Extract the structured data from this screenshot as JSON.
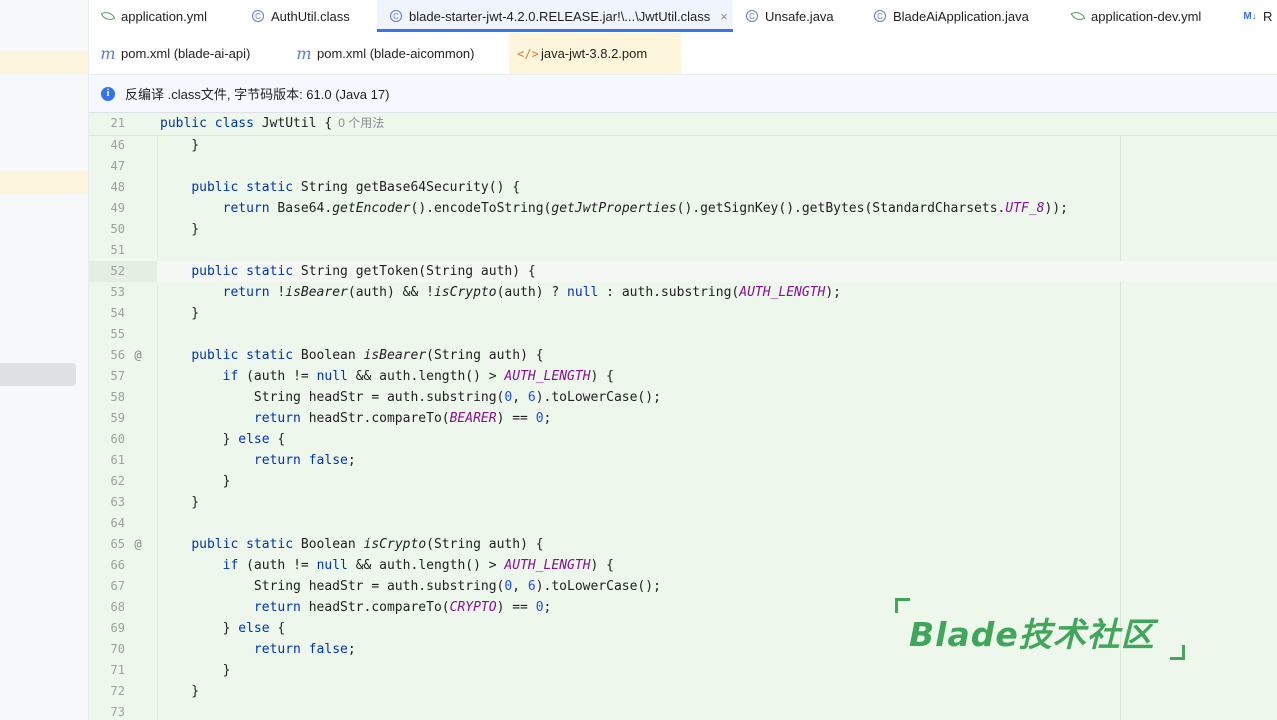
{
  "tabs_row1": [
    {
      "label": "application.yml",
      "icon": "leaf-icon",
      "active": false
    },
    {
      "label": "AuthUtil.class",
      "icon": "class-icon",
      "active": false
    },
    {
      "label": "blade-starter-jwt-4.2.0.RELEASE.jar!\\...\\JwtUtil.class",
      "icon": "class-icon",
      "active": true
    },
    {
      "label": "Unsafe.java",
      "icon": "class-icon",
      "active": false
    },
    {
      "label": "BladeAiApplication.java",
      "icon": "class-icon",
      "active": false
    },
    {
      "label": "application-dev.yml",
      "icon": "leaf-icon",
      "active": false
    },
    {
      "label": "R",
      "icon": "markdown-icon",
      "active": false
    }
  ],
  "tabs_row2": [
    {
      "label": "pom.xml (blade-ai-api)",
      "icon": "maven-icon"
    },
    {
      "label": "pom.xml (blade-aicommon)",
      "icon": "maven-icon"
    },
    {
      "label": "java-jwt-3.8.2.pom",
      "icon": "xml-icon"
    }
  ],
  "banner": {
    "text": "反编译 .class文件, 字节码版本: 61.0 (Java 17)",
    "icon": "info-icon"
  },
  "sticky": {
    "num": "21",
    "code_html": "<span class=\"kw\">public class</span> JwtUtil {<span class=\"hint\">0 个用法</span>"
  },
  "lines": [
    {
      "num": "46",
      "code": "    }"
    },
    {
      "num": "47",
      "code": ""
    },
    {
      "num": "48",
      "code": "    public static String getBase64Security() {"
    },
    {
      "num": "49",
      "code": "        return Base64.getEncoder().encodeToString(getJwtProperties().getSignKey().getBytes(StandardCharsets.UTF_8));"
    },
    {
      "num": "50",
      "code": "    }"
    },
    {
      "num": "51",
      "code": ""
    },
    {
      "num": "52",
      "code": "    public static String getToken(String auth) {",
      "current": true
    },
    {
      "num": "53",
      "code": "        return !isBearer(auth) && !isCrypto(auth) ? null : auth.substring(AUTH_LENGTH);"
    },
    {
      "num": "54",
      "code": "    }"
    },
    {
      "num": "55",
      "code": ""
    },
    {
      "num": "56",
      "code": "    public static Boolean isBearer(String auth) {",
      "marker": "@"
    },
    {
      "num": "57",
      "code": "        if (auth != null && auth.length() > AUTH_LENGTH) {"
    },
    {
      "num": "58",
      "code": "            String headStr = auth.substring(0, 6).toLowerCase();"
    },
    {
      "num": "59",
      "code": "            return headStr.compareTo(BEARER) == 0;"
    },
    {
      "num": "60",
      "code": "        } else {"
    },
    {
      "num": "61",
      "code": "            return false;"
    },
    {
      "num": "62",
      "code": "        }"
    },
    {
      "num": "63",
      "code": "    }"
    },
    {
      "num": "64",
      "code": ""
    },
    {
      "num": "65",
      "code": "    public static Boolean isCrypto(String auth) {",
      "marker": "@"
    },
    {
      "num": "66",
      "code": "        if (auth != null && auth.length() > AUTH_LENGTH) {"
    },
    {
      "num": "67",
      "code": "            String headStr = auth.substring(0, 6).toLowerCase();"
    },
    {
      "num": "68",
      "code": "            return headStr.compareTo(CRYPTO) == 0;"
    },
    {
      "num": "69",
      "code": "        } else {"
    },
    {
      "num": "70",
      "code": "            return false;"
    },
    {
      "num": "71",
      "code": "        }"
    },
    {
      "num": "72",
      "code": "    }"
    },
    {
      "num": "73",
      "code": ""
    }
  ],
  "watermark": {
    "text": "Blade技术社区"
  },
  "colors": {
    "accent": "#3574f0",
    "editor_bg": "#edf7ec",
    "keyword": "#0033b3",
    "constant": "#871094",
    "number": "#1750eb"
  }
}
